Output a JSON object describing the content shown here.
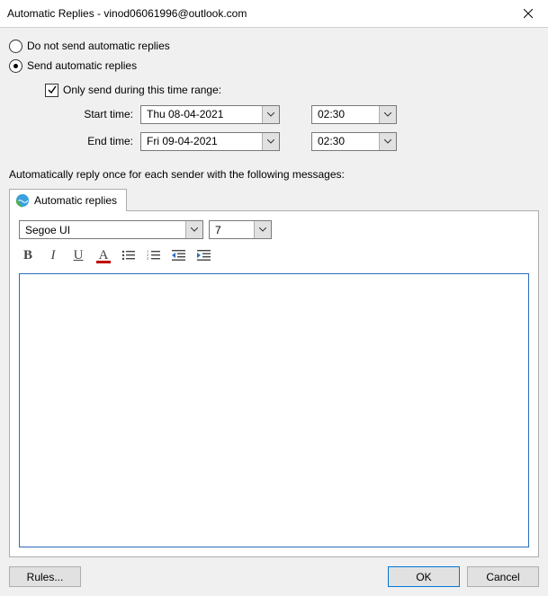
{
  "title": "Automatic Replies - vinod06061996@outlook.com",
  "radios": {
    "do_not_send": "Do not send automatic replies",
    "send": "Send automatic replies"
  },
  "checkbox_label": "Only send during this time range:",
  "time_labels": {
    "start": "Start time:",
    "end": "End time:"
  },
  "times": {
    "start_date": "Thu 08-04-2021",
    "start_time": "02:30",
    "end_date": "Fri 09-04-2021",
    "end_time": "02:30"
  },
  "instruction": "Automatically reply once for each sender with the following messages:",
  "tab_label": "Automatic replies",
  "font": {
    "name": "Segoe UI",
    "size": "7"
  },
  "buttons": {
    "rules": "Rules...",
    "ok": "OK",
    "cancel": "Cancel"
  }
}
